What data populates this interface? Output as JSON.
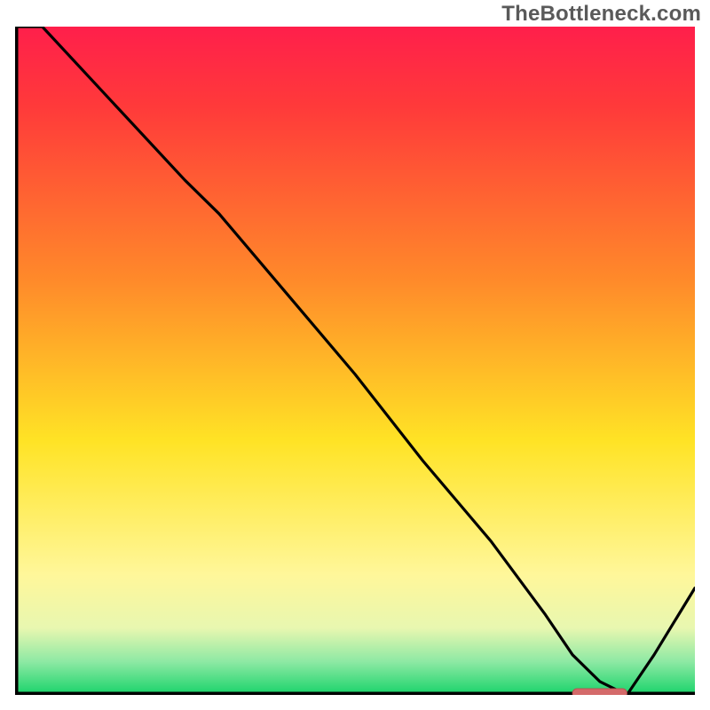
{
  "watermark": "TheBottleneck.com",
  "colors": {
    "frame": "#000000",
    "line": "#000000",
    "marker_fill": "#d46a6a",
    "marker_stroke": "#b85151",
    "grad_top": "#ff1f4b",
    "grad_red": "#ff3a3a",
    "grad_orange": "#ff8a2a",
    "grad_yellow": "#ffe325",
    "grad_lightyellow": "#fff79a",
    "grad_pale": "#e8f7b0",
    "grad_mint": "#8ee9a4",
    "grad_green": "#18d36a"
  },
  "chart_data": {
    "type": "line",
    "title": "",
    "xlabel": "",
    "ylabel": "",
    "xlim": [
      0,
      100
    ],
    "ylim": [
      0,
      100
    ],
    "x": [
      0,
      4,
      25,
      30,
      40,
      50,
      60,
      70,
      78,
      82,
      86,
      90,
      94,
      100
    ],
    "y": [
      100,
      100,
      77,
      72,
      60,
      48,
      35,
      23,
      12,
      6,
      2,
      0,
      6,
      16
    ],
    "optimal_marker": {
      "x_start": 82,
      "x_end": 90,
      "y": 0
    },
    "background": "vertical gradient red→orange→yellow→green, green band at bottom"
  }
}
